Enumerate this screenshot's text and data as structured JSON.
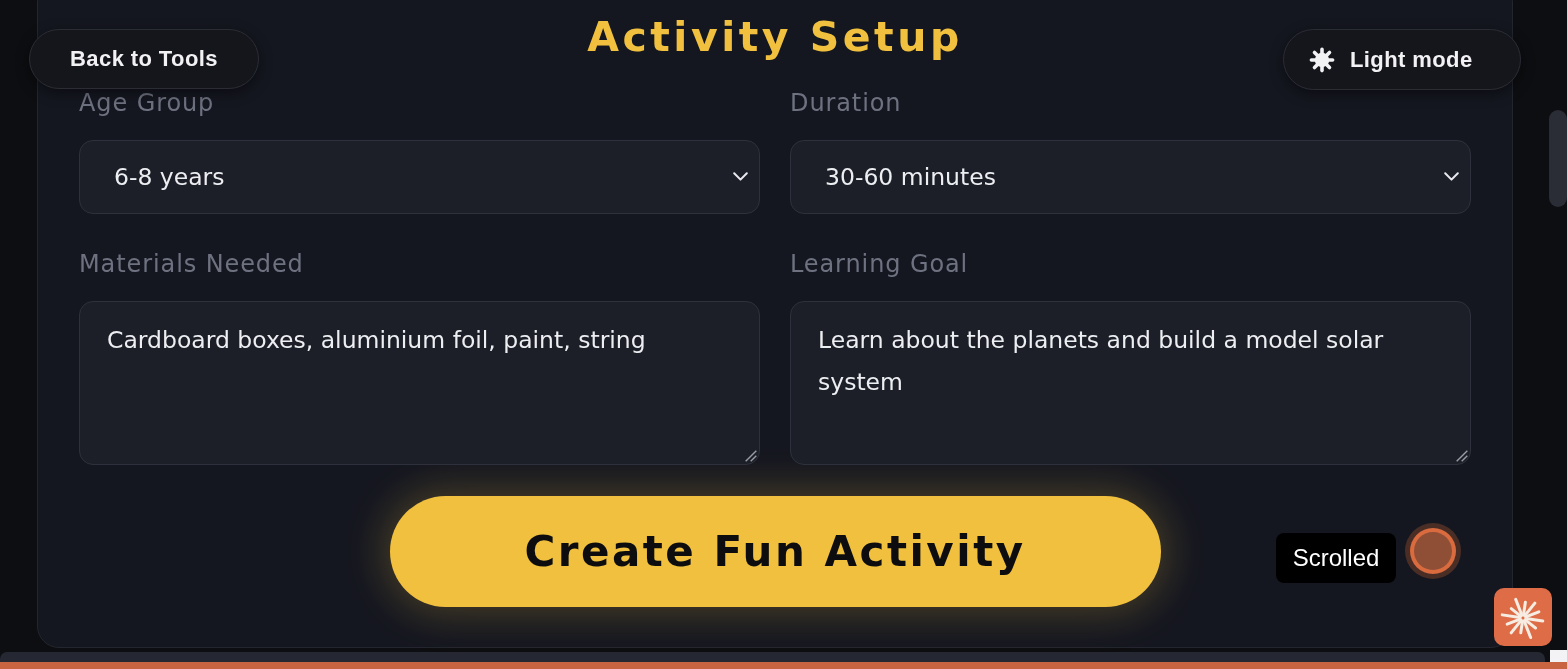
{
  "header": {
    "back_button": "Back to Tools",
    "title": "Activity Setup",
    "theme_button": "Light mode"
  },
  "form": {
    "fields": [
      {
        "kind": "select",
        "label": "Age Group",
        "value": "6-8 years"
      },
      {
        "kind": "select",
        "label": "Duration",
        "value": "30-60 minutes"
      },
      {
        "kind": "textarea",
        "label": "Materials Needed",
        "value": "Cardboard boxes, aluminium foil, paint, string"
      },
      {
        "kind": "textarea",
        "label": "Learning Goal",
        "value": "Learn about the planets and build a model solar system"
      }
    ],
    "submit_button": "Create Fun Activity"
  },
  "overlay": {
    "tooltip": "Scrolled"
  }
}
